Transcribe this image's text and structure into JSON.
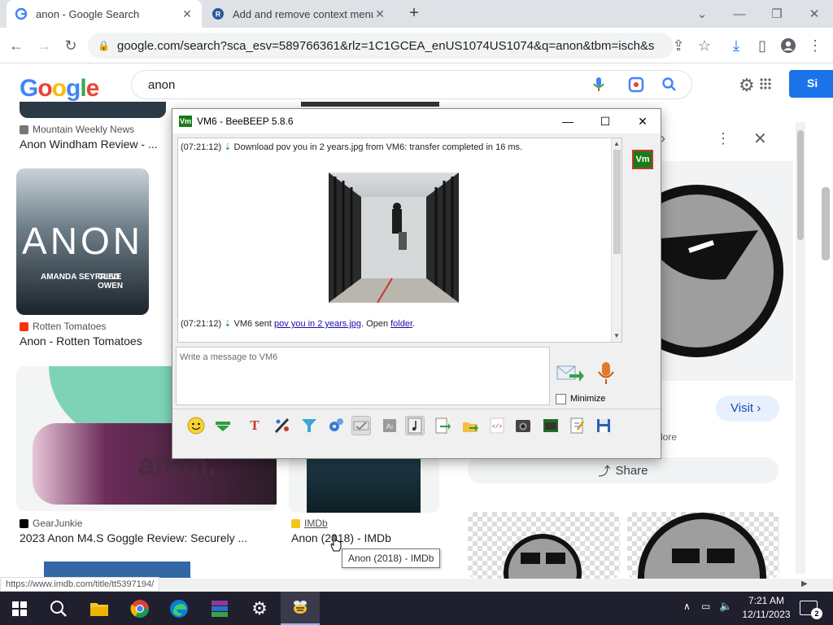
{
  "browser": {
    "tabs": [
      {
        "title": "anon - Google Search",
        "active": true
      },
      {
        "title": "Add and remove context menu i",
        "active": false
      }
    ],
    "new_tab": "+",
    "url": "google.com/search?sca_esv=589766361&rlz=1C1GCEA_enUS1074US1074&q=anon&tbm=isch&source=ln..."
  },
  "google": {
    "logo": "Google",
    "query": "anon",
    "signin_label": "Si"
  },
  "results": {
    "r1": {
      "source": "Mountain Weekly News",
      "title": "Anon Windham Review - ..."
    },
    "r2": {
      "source": "Rotten Tomatoes",
      "title": "Anon - Rotten Tomatoes",
      "poster_title": "ANON",
      "poster_names": [
        "AMANDA SEYFRIED",
        "CLIVE OWEN"
      ]
    },
    "r3": {
      "source": "GearJunkie",
      "title": "2023 Anon M4.S Goggle Review: Securely ...",
      "goggle_text": "anon."
    },
    "r4": {
      "source": "IMDb",
      "title": "Anon (2018) - IMDb"
    }
  },
  "panel": {
    "visit_label": "Visit",
    "more_fragment": "lore",
    "share_label": "Share"
  },
  "beebeep": {
    "title": "VM6 - BeeBEEP 5.8.6",
    "badge": "Vm",
    "log": [
      {
        "time": "(07:21:12)",
        "text": "Download pov you in 2 years.jpg from VM6: transfer completed in 16 ms."
      },
      {
        "time": "(07:21:12)",
        "text_before": "VM6 sent ",
        "link1": "pov you in 2 years.jpg",
        "text_mid": ". Open ",
        "link2": "folder",
        "text_after": "."
      }
    ],
    "input_placeholder": "Write a message to VM6",
    "minimize_label": "Minimize"
  },
  "status_url": "https://www.imdb.com/title/tt5397194/",
  "tooltip": "Anon (2018) - IMDb",
  "taskbar": {
    "time": "7:21 AM",
    "date": "12/11/2023",
    "notifications": "2"
  },
  "colors": {
    "google_blue": "#4285f4",
    "google_red": "#ea4335",
    "google_yellow": "#fbbc05",
    "google_green": "#34a853",
    "bee_green": "#1a7a1a",
    "taskbar_bg": "#1f1f2e",
    "link": "#1a0dab"
  }
}
